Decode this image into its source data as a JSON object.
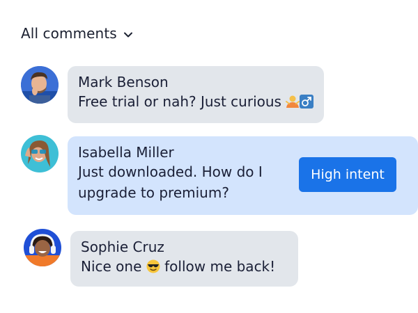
{
  "filter": {
    "label": "All comments",
    "icon": "chevron-down-icon"
  },
  "comments": [
    {
      "author": "Mark Benson",
      "text": "Free trial or nah? Just curious",
      "emoji": [
        "person-shrugging-emoji",
        "male-sign-emoji"
      ],
      "bubble_color": "#e2e6eb"
    },
    {
      "author": "Isabella Miller",
      "text": "Just downloaded. How do I upgrade to premium?",
      "badge": "High intent",
      "bubble_color": "#d3e4fd",
      "badge_color": "#1a73e8"
    },
    {
      "author": "Sophie Cruz",
      "text_before": "Nice one",
      "text_after": "follow me back!",
      "emoji": [
        "sunglasses-face-emoji"
      ],
      "bubble_color": "#e2e6eb"
    }
  ]
}
